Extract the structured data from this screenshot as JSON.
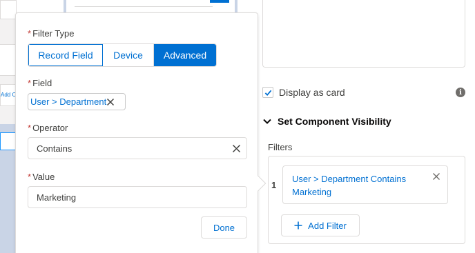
{
  "background": {
    "add_component_snippet": "Add Co"
  },
  "filter_popover": {
    "filter_type_label": "Filter Type",
    "filter_type_options": [
      "Record Field",
      "Device",
      "Advanced"
    ],
    "filter_type_selected": "Advanced",
    "field_label": "Field",
    "field_value": "User > Department",
    "operator_label": "Operator",
    "operator_value": "Contains",
    "value_label": "Value",
    "value_value": "Marketing",
    "done_label": "Done",
    "required_marker": "*"
  },
  "properties": {
    "display_as_card_label": "Display as card",
    "display_as_card_checked": true,
    "info_icon_glyph": "i",
    "visibility_header": "Set Component Visibility",
    "filters_label": "Filters",
    "filters": [
      {
        "number": "1",
        "text": "User > Department Contains Marketing"
      }
    ],
    "add_filter_label": "Add Filter"
  },
  "colors": {
    "brand_blue": "#0070d2",
    "required_red": "#c23934",
    "border_gray": "#dddbda"
  }
}
